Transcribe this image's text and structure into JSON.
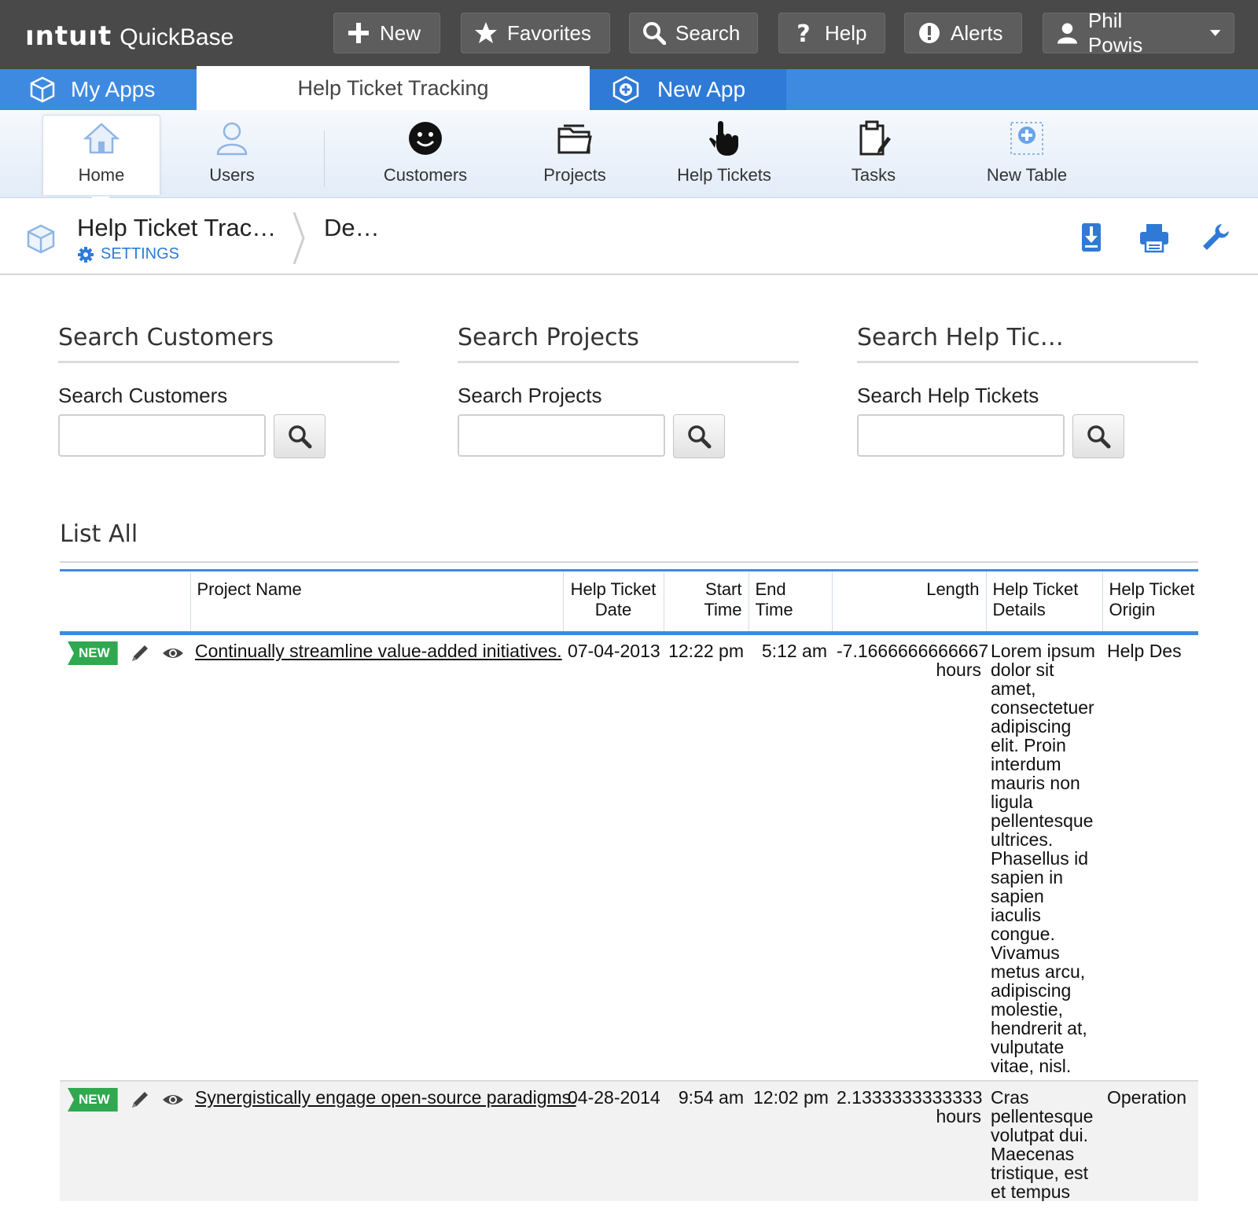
{
  "logo": {
    "brand": "ıntuıt",
    "product": "QuickBase"
  },
  "topbar": {
    "new": "New",
    "favorites": "Favorites",
    "search": "Search",
    "help": "Help",
    "alerts": "Alerts",
    "user": "Phil Powis"
  },
  "app_tabs": {
    "my_apps": "My Apps",
    "active": "Help Ticket Tracking",
    "new_app": "New App"
  },
  "table_nav": {
    "items": [
      "Home",
      "Users",
      "Customers",
      "Projects",
      "Help Tickets",
      "Tasks",
      "New Table"
    ]
  },
  "page_header": {
    "app_title": "Help Ticket Trac…",
    "settings": "SETTINGS",
    "crumb": "De…"
  },
  "search_sections": [
    {
      "heading": "Search Customers",
      "label": "Search Customers",
      "value": ""
    },
    {
      "heading": "Search Projects",
      "label": "Search Projects",
      "value": ""
    },
    {
      "heading": "Search Help Tic…",
      "label": "Search Help Tickets",
      "value": ""
    }
  ],
  "report": {
    "title": "List All",
    "columns": [
      "",
      "Project Name",
      "Help Ticket Date",
      "Start Time",
      "End Time",
      "Length",
      "Help Ticket Details",
      "Help Ticket Origin"
    ],
    "rows": [
      {
        "badge": "NEW",
        "project": "Continually streamline value-added initiatives.",
        "date": "07-04-2013",
        "start": "12:22 pm",
        "end": "5:12 am",
        "length": "-7.1666666666667",
        "length_unit": "hours",
        "details": "Lorem ipsum dolor sit amet, consectetuer adipiscing elit. Proin interdum mauris non ligula pellentesque ultrices. Phasellus id sapien in sapien iaculis congue. Vivamus metus arcu, adipiscing molestie, hendrerit at, vulputate vitae, nisl.",
        "origin": "Help Des"
      },
      {
        "badge": "NEW",
        "project": "Synergistically engage open-source paradigms.",
        "date": "04-28-2014",
        "start": "9:54 am",
        "end": "12:02 pm",
        "length": "2.1333333333333",
        "length_unit": "hours",
        "details": "Cras pellentesque volutpat dui. Maecenas tristique, est et tempus semper, est",
        "origin": "Operation"
      }
    ]
  }
}
